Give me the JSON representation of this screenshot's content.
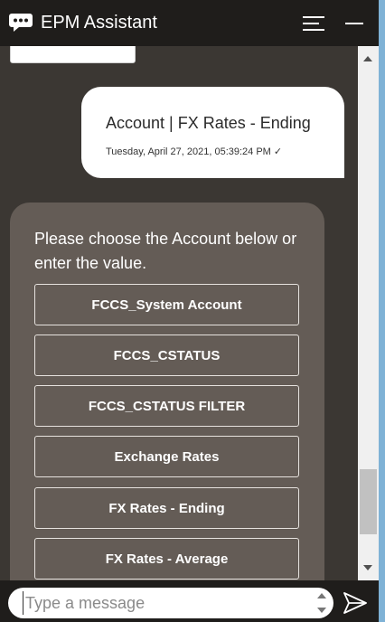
{
  "header": {
    "title": "EPM Assistant",
    "logo_icon": "chat-bubble-icon",
    "menu_icon": "hamburger-menu-icon",
    "minimize_icon": "minimize-icon"
  },
  "conversation": {
    "user_message": {
      "text": "Account  |  FX Rates - Ending",
      "timestamp": "Tuesday, April 27, 2021, 05:39:24 PM ✓"
    },
    "bot_message": {
      "prompt": "Please choose the Account below or enter the value.",
      "choices": [
        {
          "label": "FCCS_System Account"
        },
        {
          "label": "FCCS_CSTATUS"
        },
        {
          "label": "FCCS_CSTATUS FILTER"
        },
        {
          "label": "Exchange Rates"
        },
        {
          "label": "FX Rates - Ending"
        },
        {
          "label": "FX Rates - Average"
        }
      ]
    }
  },
  "input": {
    "placeholder": "Type a message",
    "send_icon": "send-icon"
  },
  "colors": {
    "header_bg": "#1f1d1b",
    "conversation_bg": "#3b3733",
    "bot_bubble_bg": "#645c56",
    "user_bubble_bg": "#ffffff"
  }
}
